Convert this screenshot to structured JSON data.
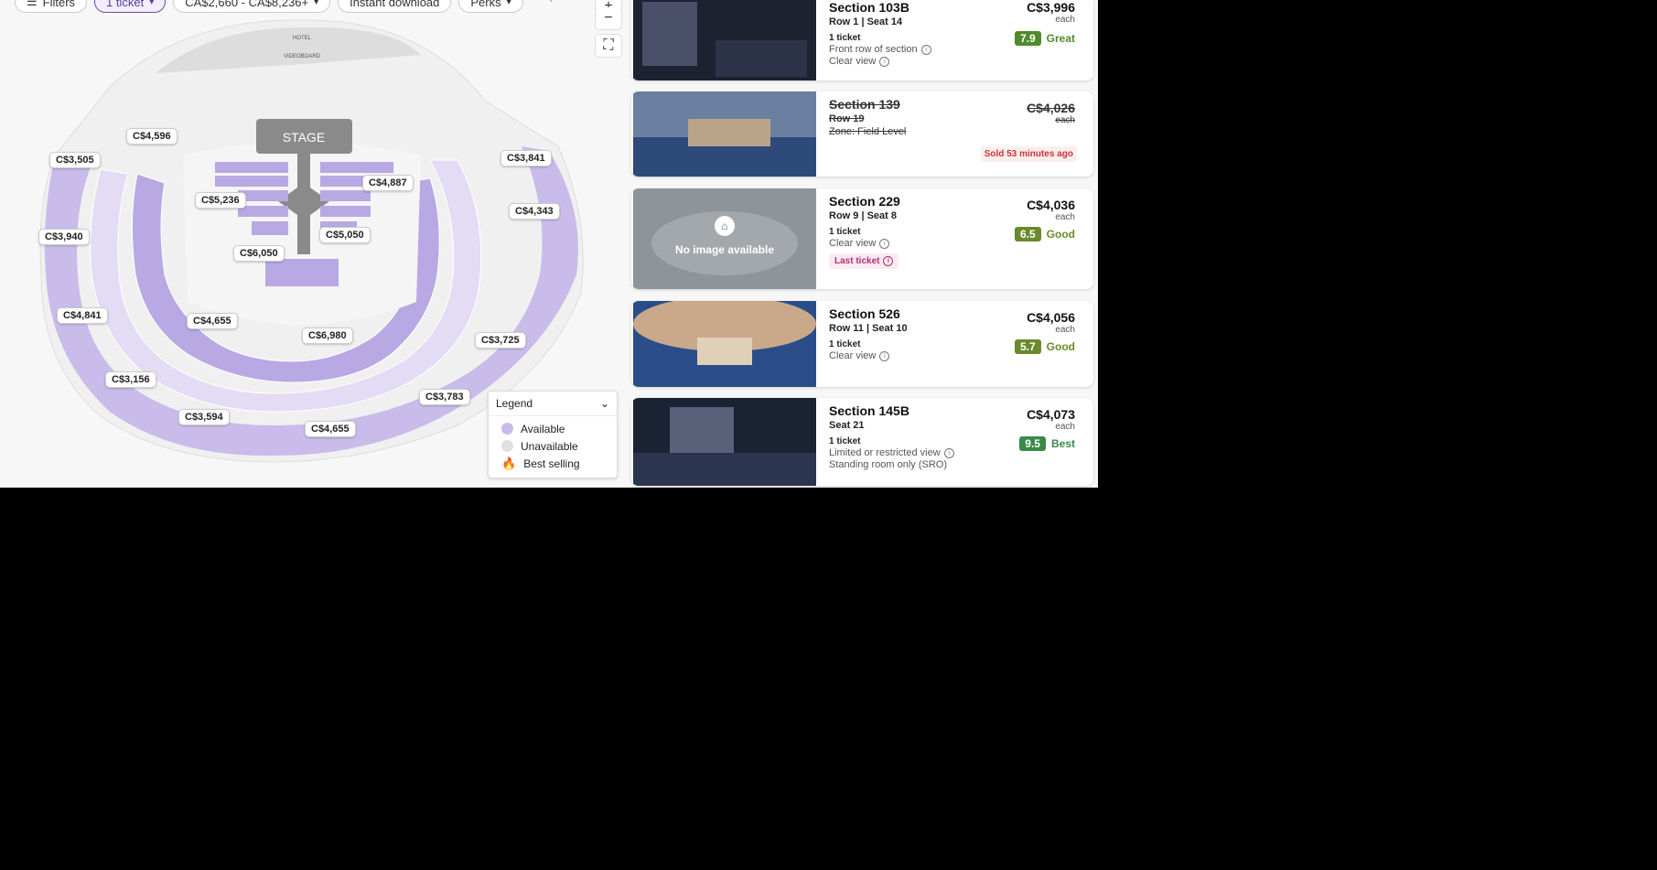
{
  "filters": {
    "filters_label": "Filters",
    "tickets_label": "1 ticket",
    "price_range": "CA$2,660 - CA$8,236+",
    "instant_download": "Instant download",
    "perks": "Perks"
  },
  "map_controls": {
    "zoom_in": "+",
    "zoom_out": "−"
  },
  "map": {
    "stage_label": "STAGE",
    "top_labels": [
      "HOTEL",
      "VIDEOBOARD"
    ],
    "price_pins": [
      "C$4,596",
      "C$3,505",
      "C$3,841",
      "C$5,236",
      "C$4,887",
      "C$4,343",
      "C$3,940",
      "C$5,050",
      "C$6,050",
      "C$4,841",
      "C$4,655",
      "C$6,980",
      "C$3,725",
      "C$3,156",
      "C$3,783",
      "C$3,594",
      "C$4,655"
    ]
  },
  "legend": {
    "title": "Legend",
    "items": [
      {
        "label": "Available",
        "color": "#c9bcea"
      },
      {
        "label": "Unavailable",
        "color": "#e0e0e0"
      },
      {
        "label": "Best selling",
        "color": "#d43a6b"
      }
    ]
  },
  "listings": [
    {
      "section": "Section 103B",
      "row_seat": "Row 1 | Seat 14",
      "qty": "1 ticket",
      "notes": [
        "Front row of section",
        "Clear view"
      ],
      "price": "C$3,996",
      "each": "each",
      "score": "7.9",
      "rating": "Great",
      "score_color": "#4f8a2b"
    },
    {
      "section": "Section 139",
      "row_seat": "Row 19",
      "zone": "Zone: Field Level",
      "price": "C$4,026",
      "each": "each",
      "sold_text": "Sold 53 minutes ago"
    },
    {
      "section": "Section 229",
      "row_seat": "Row 9 | Seat 8",
      "qty": "1 ticket",
      "notes": [
        "Clear view"
      ],
      "badge": "Last ticket",
      "no_image": "No image available",
      "price": "C$4,036",
      "each": "each",
      "score": "6.5",
      "rating": "Good",
      "score_color": "#6a8a2b"
    },
    {
      "section": "Section 526",
      "row_seat": "Row 11 | Seat 10",
      "qty": "1 ticket",
      "notes": [
        "Clear view"
      ],
      "price": "C$4,056",
      "each": "each",
      "score": "5.7",
      "rating": "Good",
      "score_color": "#6a8a2b"
    },
    {
      "section": "Section 145B",
      "row_seat": "Seat 21",
      "qty": "1 ticket",
      "notes": [
        "Limited or restricted view",
        "Standing room only (SRO)"
      ],
      "price": "C$4,073",
      "each": "each",
      "score": "9.5",
      "rating": "Best",
      "score_color": "#3a8a4a"
    }
  ]
}
